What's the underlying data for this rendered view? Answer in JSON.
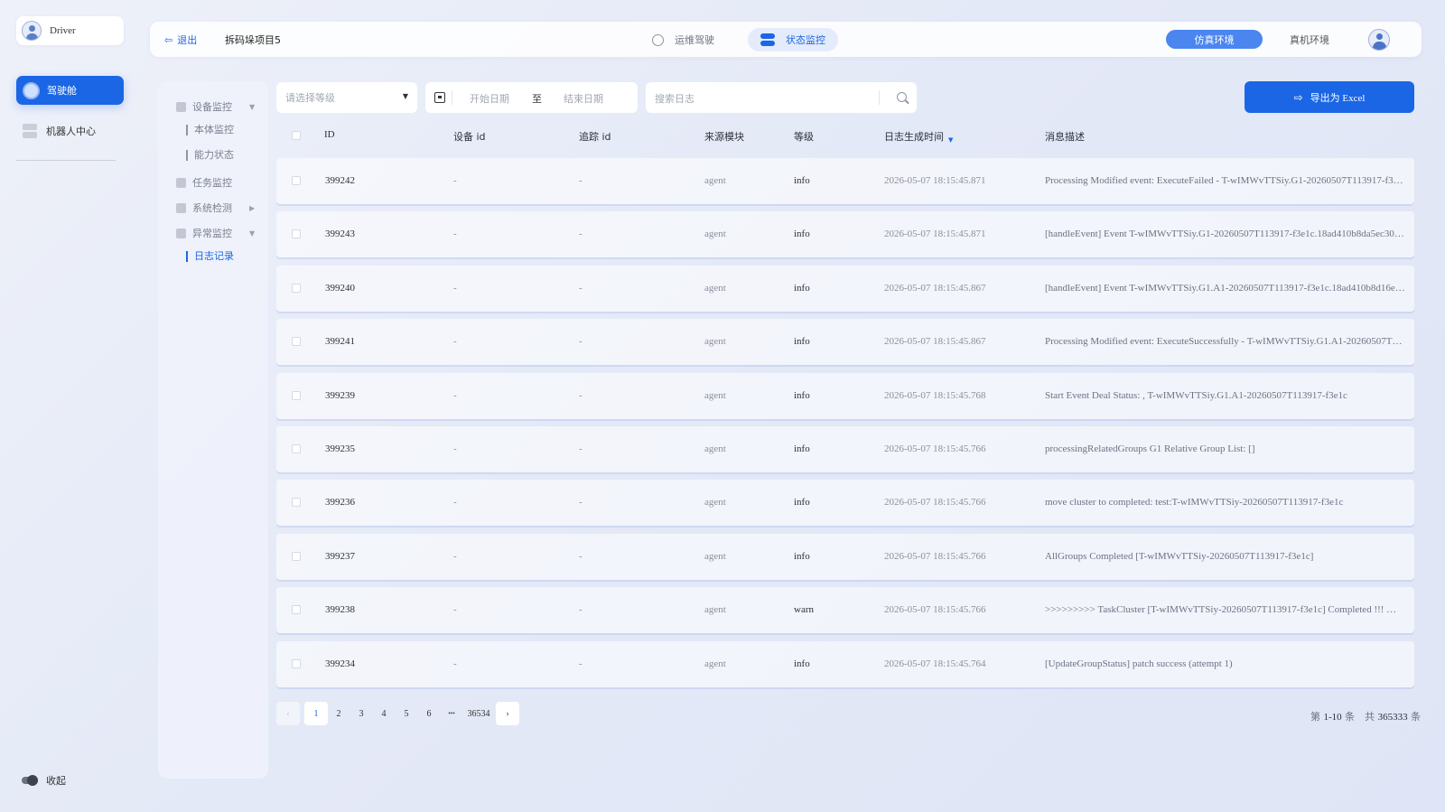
{
  "sidebar": {
    "user_name": "Driver",
    "active_item": "驾驶舱",
    "robot_center": "机器人中心",
    "collapse_label": "收起"
  },
  "topbar": {
    "logout_label": "退出",
    "project_name": "拆码垛项目5",
    "mode_ops": "运维驾驶",
    "mode_status": "状态监控",
    "env_sim": "仿真环境",
    "env_real": "真机环境"
  },
  "submenu": {
    "device_monitor": "设备监控",
    "body_monitor": "本体监控",
    "capability_status": "能力状态",
    "task_monitor": "任务监控",
    "system_check": "系统检测",
    "anomaly_monitor": "异常监控",
    "log_record": "日志记录"
  },
  "filters": {
    "level_placeholder": "请选择等级",
    "start_date": "开始日期",
    "to": "至",
    "end_date": "结束日期",
    "search_placeholder": "搜索日志",
    "export_label": "导出为 Excel"
  },
  "table": {
    "headers": {
      "id": "ID",
      "device_id": "设备 id",
      "trace_id": "追踪 id",
      "module": "来源模块",
      "level": "等级",
      "time": "日志生成时间",
      "message": "消息描述"
    },
    "rows": [
      {
        "id": "399242",
        "device": "-",
        "trace": "-",
        "module": "agent",
        "level": "info",
        "time": "2026-05-07 18:15:45.871",
        "message": "Processing Modified event: ExecuteFailed - T-wIMWvTTSiy.G1-20260507T113917-f3…"
      },
      {
        "id": "399243",
        "device": "-",
        "trace": "-",
        "module": "agent",
        "level": "info",
        "time": "2026-05-07 18:15:45.871",
        "message": "[handleEvent] Event T-wIMWvTTSiy.G1-20260507T113917-f3e1c.18ad410b8da5ec30…"
      },
      {
        "id": "399240",
        "device": "-",
        "trace": "-",
        "module": "agent",
        "level": "info",
        "time": "2026-05-07 18:15:45.867",
        "message": "[handleEvent] Event T-wIMWvTTSiy.G1.A1-20260507T113917-f3e1c.18ad410b8d16e…"
      },
      {
        "id": "399241",
        "device": "-",
        "trace": "-",
        "module": "agent",
        "level": "info",
        "time": "2026-05-07 18:15:45.867",
        "message": "Processing Modified event: ExecuteSuccessfully - T-wIMWvTTSiy.G1.A1-20260507T…"
      },
      {
        "id": "399239",
        "device": "-",
        "trace": "-",
        "module": "agent",
        "level": "info",
        "time": "2026-05-07 18:15:45.768",
        "message": "Start Event Deal Status: , T-wIMWvTTSiy.G1.A1-20260507T113917-f3e1c"
      },
      {
        "id": "399235",
        "device": "-",
        "trace": "-",
        "module": "agent",
        "level": "info",
        "time": "2026-05-07 18:15:45.766",
        "message": "processingRelatedGroups G1 Relative Group List: []"
      },
      {
        "id": "399236",
        "device": "-",
        "trace": "-",
        "module": "agent",
        "level": "info",
        "time": "2026-05-07 18:15:45.766",
        "message": "move cluster to completed: test:T-wIMWvTTSiy-20260507T113917-f3e1c"
      },
      {
        "id": "399237",
        "device": "-",
        "trace": "-",
        "module": "agent",
        "level": "info",
        "time": "2026-05-07 18:15:45.766",
        "message": "AllGroups Completed [T-wIMWvTTSiy-20260507T113917-f3e1c]"
      },
      {
        "id": "399238",
        "device": "-",
        "trace": "-",
        "module": "agent",
        "level": "warn",
        "time": "2026-05-07 18:15:45.766",
        "message": ">>>>>>>>> TaskCluster [T-wIMWvTTSiy-20260507T113917-f3e1c] Completed !!! …"
      },
      {
        "id": "399234",
        "device": "-",
        "trace": "-",
        "module": "agent",
        "level": "info",
        "time": "2026-05-07 18:15:45.764",
        "message": "[UpdateGroupStatus] patch success (attempt 1)"
      }
    ]
  },
  "pagination": {
    "prev": "‹",
    "pages": [
      "1",
      "2",
      "3",
      "4",
      "5",
      "6"
    ],
    "ellipsis": "•••",
    "last": "36534",
    "next": "›",
    "summary_prefix": "第",
    "summary_range": "1-10",
    "summary_mid": "条　共",
    "summary_total": "365333",
    "summary_suffix": "条"
  }
}
